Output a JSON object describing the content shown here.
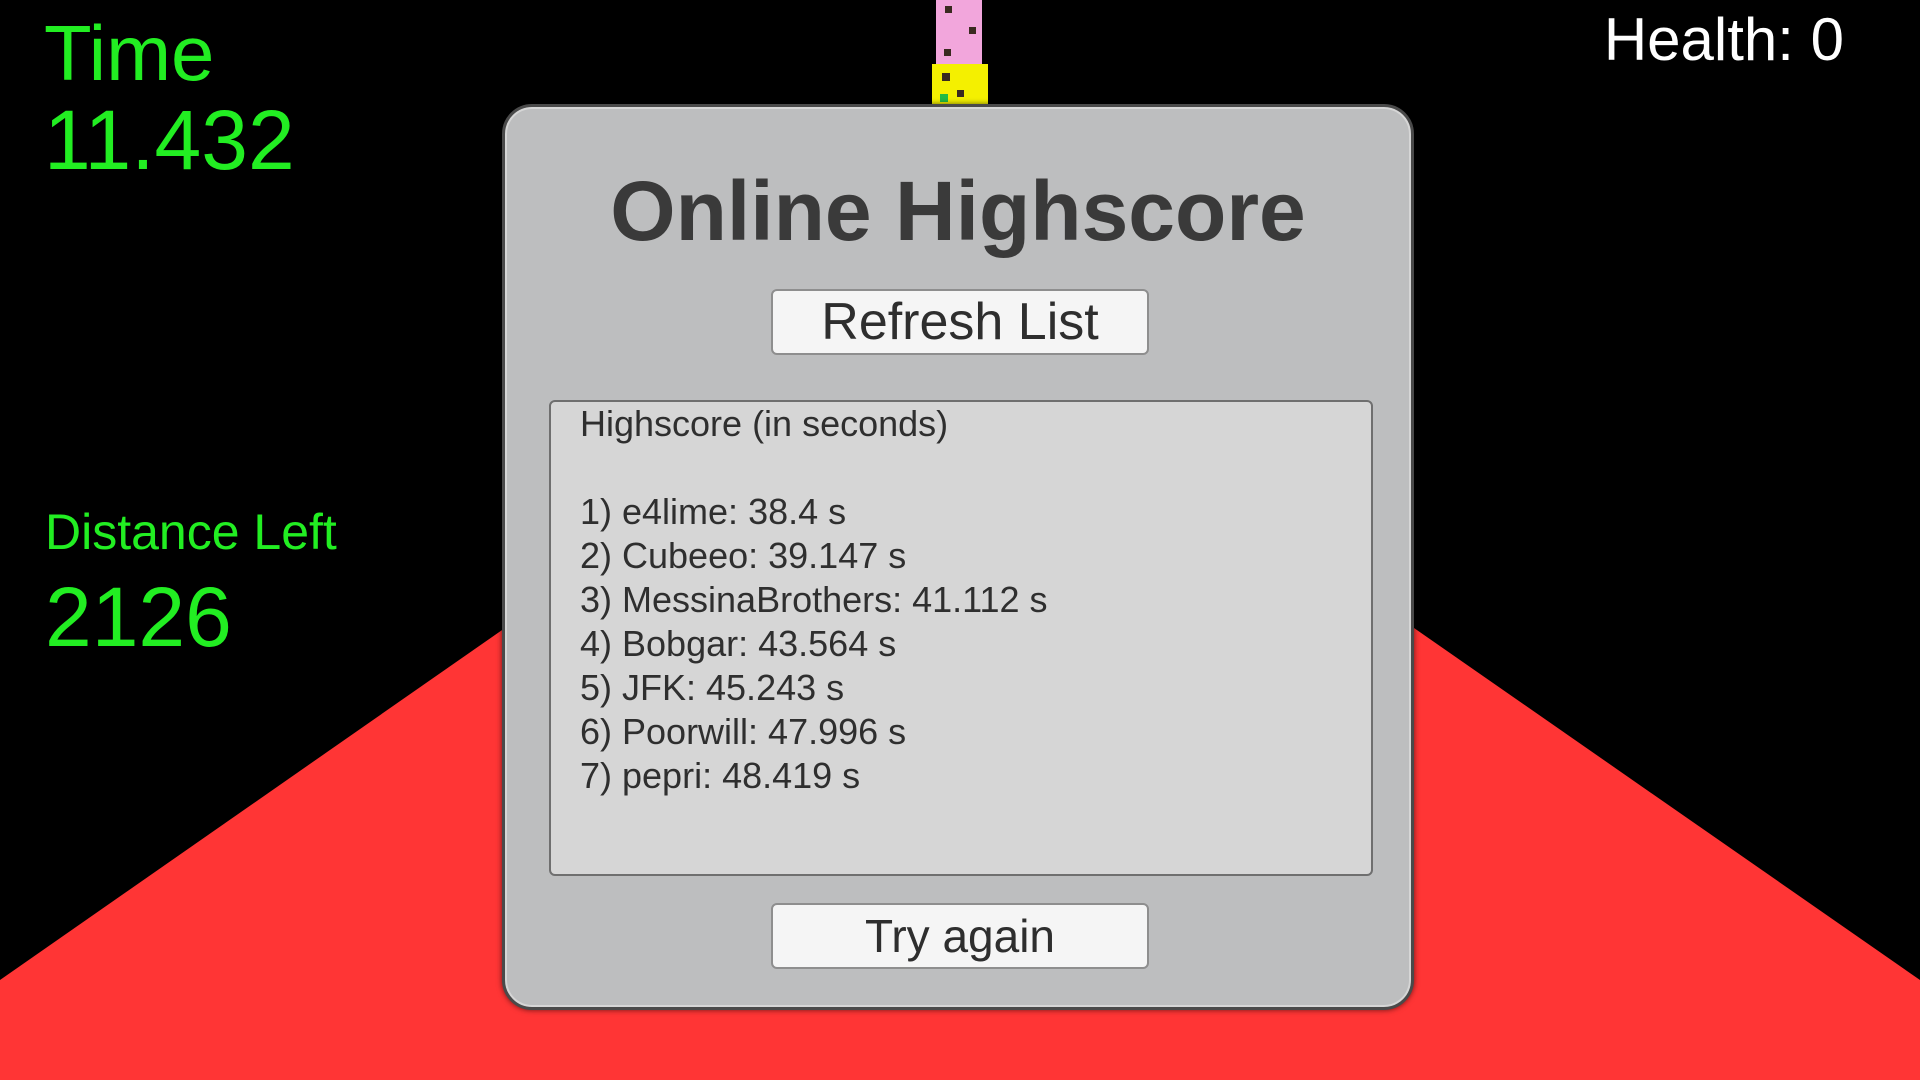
{
  "hud": {
    "time_label": "Time",
    "time_value": "11.432",
    "distance_label": "Distance Left",
    "distance_value": "2126",
    "health_text": "Health: 0",
    "hud_color": "#22ee22",
    "health_color": "#ffffff"
  },
  "scene": {
    "floor_color": "#ff3535",
    "sky_color": "#000000"
  },
  "panel": {
    "title": "Online Highscore",
    "refresh_label": "Refresh List",
    "score_heading": "Highscore (in seconds)",
    "entries": [
      "1) e4lime: 38.4 s",
      "2) Cubeeo: 39.147 s",
      "3) MessinaBrothers: 41.112 s",
      "4) Bobgar: 43.564 s",
      "5) JFK: 45.243 s",
      "6) Poorwill: 47.996 s",
      "7) pepri: 48.419 s"
    ],
    "try_again_label": "Try again"
  }
}
